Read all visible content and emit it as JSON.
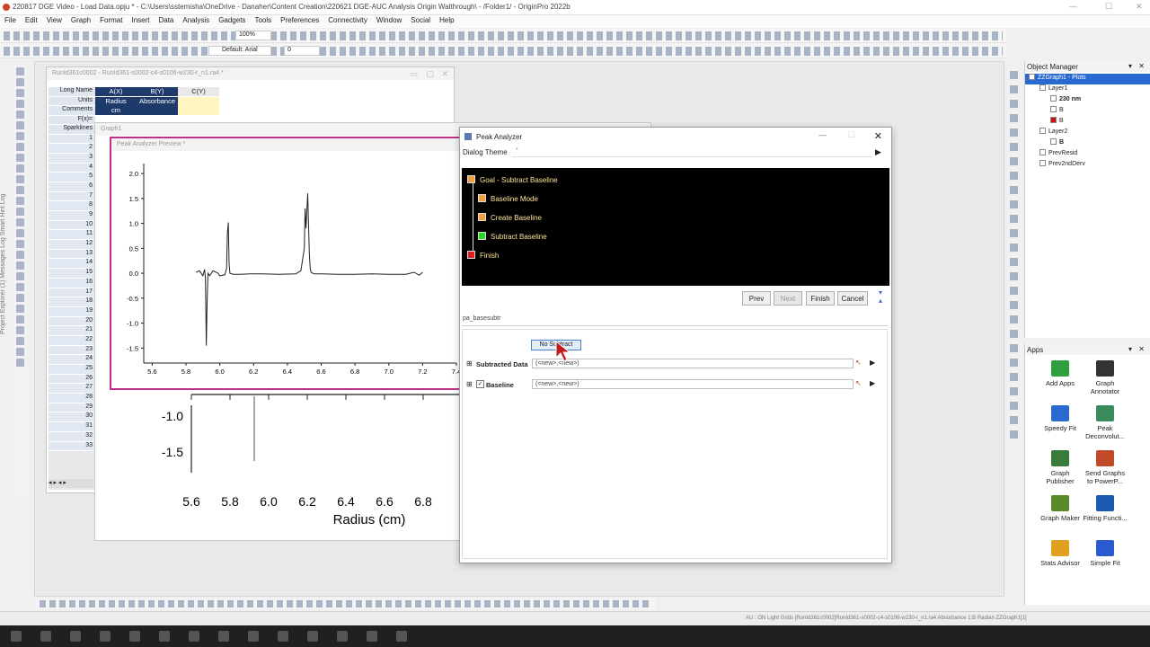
{
  "app": {
    "title": "220817 DGE Video - Load Data.opju * - C:\\Users\\sstemisha\\OneDrive - Danaher\\Content Creation\\220621 DGE-AUC Analysis Origin Walthrough\\ - /Folder1/ - OriginPro 2022b"
  },
  "menu": [
    "File",
    "Edit",
    "View",
    "Graph",
    "Format",
    "Insert",
    "Data",
    "Analysis",
    "Gadgets",
    "Tools",
    "Preferences",
    "Connectivity",
    "Window",
    "Social",
    "Help"
  ],
  "toolbar": {
    "zoom": "100%",
    "font": "Default: Arial",
    "font_size": "0"
  },
  "left_tabs": "Project Explorer (1)   Messages Log   Smart Hint Log",
  "workbook": {
    "title": "RunId361c0002 - RunId361-s0002-c4-s0106-w230-r_n1.ra4 *",
    "columns": [
      "A(X)",
      "B(Y)",
      "C(Y)"
    ],
    "row_labels": [
      "Long Name",
      "Units",
      "Comments",
      "F(x)=",
      "Sparklines"
    ],
    "long_names": [
      "Radius",
      "Absorbance"
    ],
    "units": [
      "cm"
    ],
    "rows": [
      "1",
      "2",
      "3",
      "4",
      "5",
      "6",
      "7",
      "8",
      "9",
      "10",
      "11",
      "12",
      "13",
      "14",
      "15",
      "16",
      "17",
      "18",
      "19",
      "20",
      "21",
      "22",
      "23",
      "24",
      "25",
      "26",
      "27",
      "28",
      "29",
      "30",
      "31",
      "32",
      "33"
    ]
  },
  "graph1": {
    "title": "Graph1",
    "y_ticks": [
      "-1.0",
      "-1.5"
    ],
    "x_ticks": [
      "5.6",
      "5.8",
      "6.0",
      "6.2",
      "6.4",
      "6.6",
      "6.8"
    ],
    "xlabel": "Radius (cm)"
  },
  "preview": {
    "title": "Peak Analyzer Preview *",
    "chart_data": {
      "type": "line",
      "xlim": [
        5.55,
        7.4
      ],
      "ylim": [
        -1.8,
        2.2
      ],
      "y_ticks": [
        "2.0",
        "1.5",
        "1.0",
        "0.5",
        "0.0",
        "-0.5",
        "-1.0",
        "-1.5"
      ],
      "x_ticks": [
        "5.6",
        "5.8",
        "6.0",
        "6.2",
        "6.4",
        "6.6",
        "6.8",
        "7.0",
        "7.2",
        "7.4"
      ],
      "series": [
        {
          "x": [
            5.86,
            5.88,
            5.9,
            5.91,
            5.915,
            5.92,
            5.925,
            5.93,
            5.94,
            5.96,
            5.99,
            6.0,
            6.03,
            6.04,
            6.045,
            6.05,
            6.055,
            6.06,
            6.08,
            6.12,
            6.18,
            6.25,
            6.35,
            6.45,
            6.48,
            6.5,
            6.505,
            6.51,
            6.52,
            6.525,
            6.53,
            6.535,
            6.54,
            6.55,
            6.56,
            6.6,
            6.7,
            6.8,
            6.9,
            7.0,
            7.1,
            7.15,
            7.18,
            7.2
          ],
          "y": [
            0.02,
            0.05,
            -0.05,
            0.08,
            -0.1,
            -1.45,
            -0.6,
            0.0,
            -0.05,
            0.05,
            0.0,
            -0.05,
            -0.03,
            0.1,
            0.8,
            1.02,
            0.2,
            0.0,
            -0.02,
            -0.02,
            -0.01,
            -0.01,
            -0.02,
            -0.01,
            0.05,
            0.5,
            1.3,
            0.9,
            1.6,
            1.0,
            0.4,
            0.1,
            0.02,
            0.0,
            -0.01,
            -0.01,
            -0.02,
            -0.02,
            -0.01,
            -0.02,
            -0.02,
            0.02,
            -0.04,
            0.02
          ]
        }
      ]
    }
  },
  "peak_analyzer": {
    "title": "Peak Analyzer",
    "dialog_theme_label": "Dialog Theme",
    "dialog_theme_value": "*",
    "steps": [
      {
        "label": "Goal - Subtract Baseline",
        "color": "#f0a040"
      },
      {
        "label": "Baseline Mode",
        "color": "#f0a040"
      },
      {
        "label": "Create Baseline",
        "color": "#f0a040"
      },
      {
        "label": "Subtract Baseline",
        "color": "#2ad62a"
      },
      {
        "label": "Finish",
        "color": "#e02020"
      }
    ],
    "buttons": {
      "prev": "Prev",
      "next": "Next",
      "finish": "Finish",
      "cancel": "Cancel"
    },
    "section": "pa_basesubtr",
    "no_subtract": "No Subtract",
    "subtracted_label": "Subtracted Data",
    "subtracted_value": "(<new>,<new>)",
    "baseline_label": "Baseline",
    "baseline_value": "(<new>,<new>)"
  },
  "object_manager": {
    "title": "Object Manager",
    "items": [
      {
        "text": "ZZGraph1 - Plots",
        "indent": 0,
        "sel": true
      },
      {
        "text": "Layer1",
        "indent": 1
      },
      {
        "text": "230 nm",
        "indent": 2,
        "bold": true
      },
      {
        "text": "B",
        "indent": 2
      },
      {
        "text": "B",
        "indent": 2,
        "red": true
      },
      {
        "text": "Layer2",
        "indent": 1
      },
      {
        "text": "B",
        "indent": 2,
        "bold": true
      },
      {
        "text": "PrevResid",
        "indent": 1
      },
      {
        "text": "Prev2ndDerv",
        "indent": 1
      }
    ]
  },
  "apps": {
    "title": "Apps",
    "items": [
      {
        "name": "Add Apps",
        "color": "#2e9e3e"
      },
      {
        "name": "Graph Annotator",
        "color": "#333333"
      },
      {
        "name": "Speedy Fit",
        "color": "#2a6ad0"
      },
      {
        "name": "Peak Deconvolut...",
        "color": "#3a8a5a"
      },
      {
        "name": "Graph Publisher",
        "color": "#3a7a3a"
      },
      {
        "name": "Send Graphs to PowerP...",
        "color": "#c04a2a"
      },
      {
        "name": "Graph Maker",
        "color": "#5a8a2a"
      },
      {
        "name": "Fitting Functi...",
        "color": "#1a5ab0"
      },
      {
        "name": "Stats Advisor",
        "color": "#e0a020"
      },
      {
        "name": "Simple Fit",
        "color": "#2a5ad0"
      }
    ]
  },
  "status": "AU : ON  Light Grids  [RunId361c0002]RunId361-s0002-c4-s0106-w230-r_n1.ra4  Absorbance  1:B  Radian  ZZGraph1[1]"
}
